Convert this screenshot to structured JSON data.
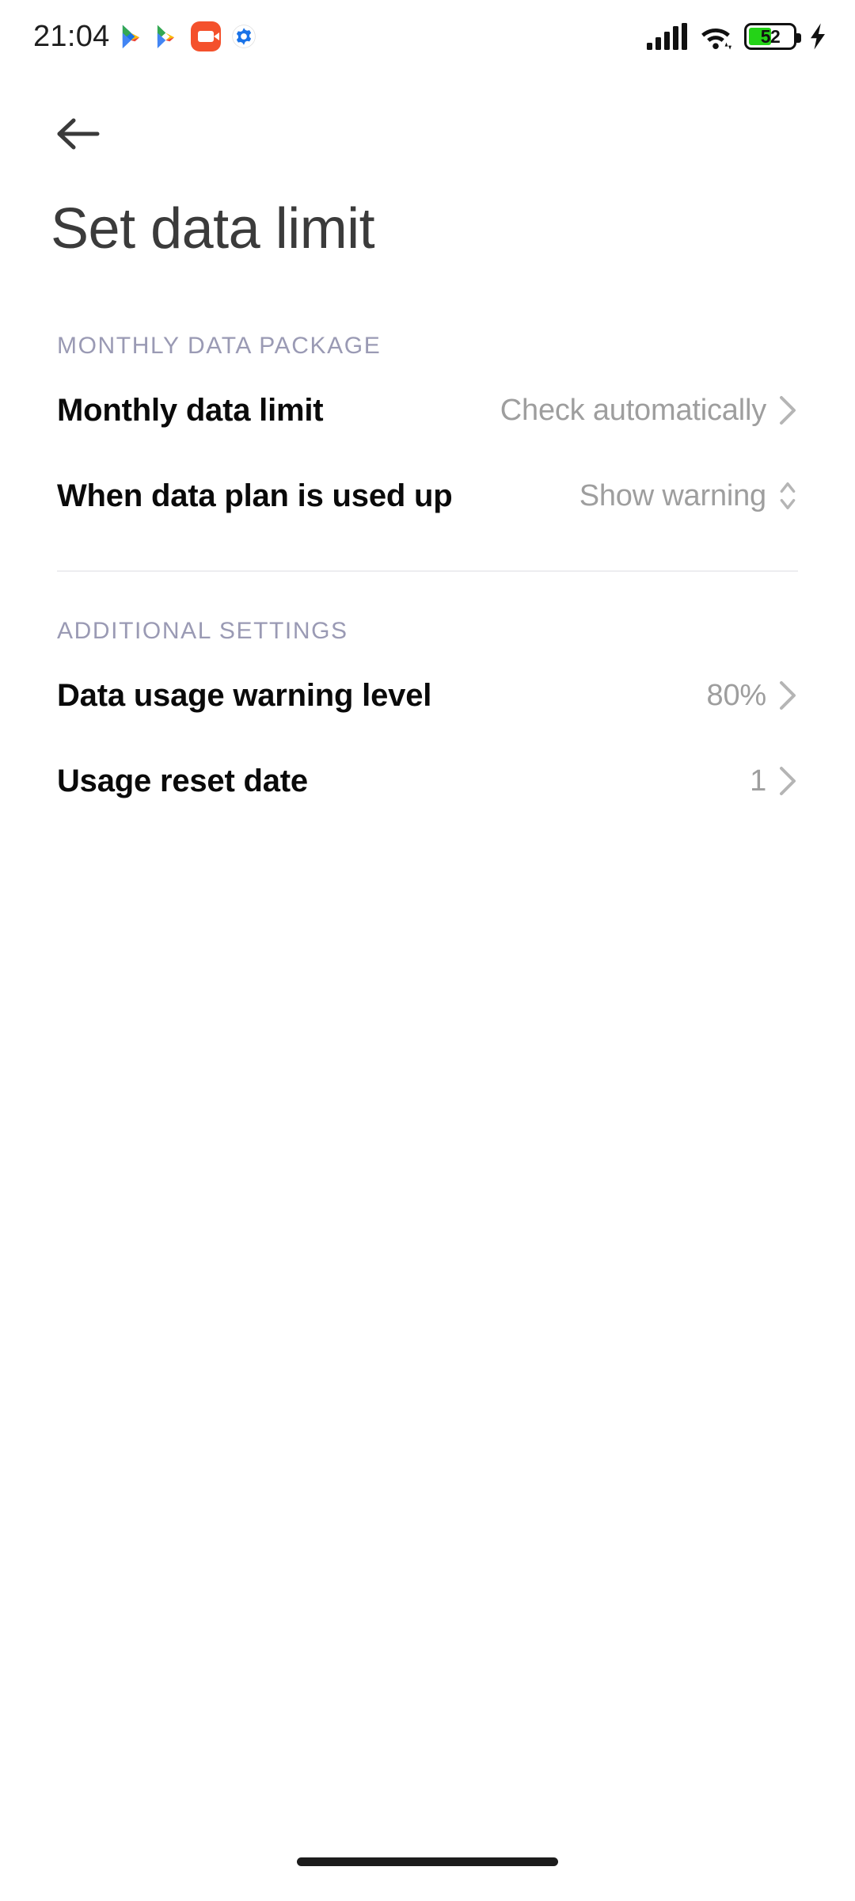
{
  "status_bar": {
    "time": "21:04",
    "left_icons": [
      "play-store-icon",
      "play-store-icon",
      "screen-recorder-icon",
      "google-settings-gear-icon"
    ],
    "right_icons": [
      "cellular-signal-icon",
      "wifi-icon",
      "battery-icon",
      "charging-bolt-icon"
    ],
    "battery_percent": "52",
    "battery_level": 52,
    "battery_color": "#24d317",
    "charging": true
  },
  "nav": {
    "back_icon": "back-arrow-icon"
  },
  "header": {
    "title": "Set data limit"
  },
  "sections": [
    {
      "title": "MONTHLY DATA PACKAGE",
      "rows": [
        {
          "label": "Monthly data limit",
          "value": "Check automatically",
          "accessory": "chevron-right-icon",
          "name": "monthly-data-limit"
        },
        {
          "label": "When data plan is used up",
          "value": "Show warning",
          "accessory": "up-down-chevron-icon",
          "name": "when-data-plan-used-up"
        }
      ]
    },
    {
      "title": "ADDITIONAL SETTINGS",
      "rows": [
        {
          "label": "Data usage warning level",
          "value": "80%",
          "accessory": "chevron-right-icon",
          "name": "data-usage-warning-level"
        },
        {
          "label": "Usage reset date",
          "value": "1",
          "accessory": "chevron-right-icon",
          "name": "usage-reset-date"
        }
      ]
    }
  ],
  "colors": {
    "background": "#ffffff",
    "title_text": "#3b3b3b",
    "label_text": "#0a0a0a",
    "value_text": "#9e9e9e",
    "section_header": "#9a9ab4",
    "divider": "#ededf0",
    "recorder_orange": "#f4512c"
  },
  "system_nav": {
    "home_indicator": "home-indicator"
  }
}
